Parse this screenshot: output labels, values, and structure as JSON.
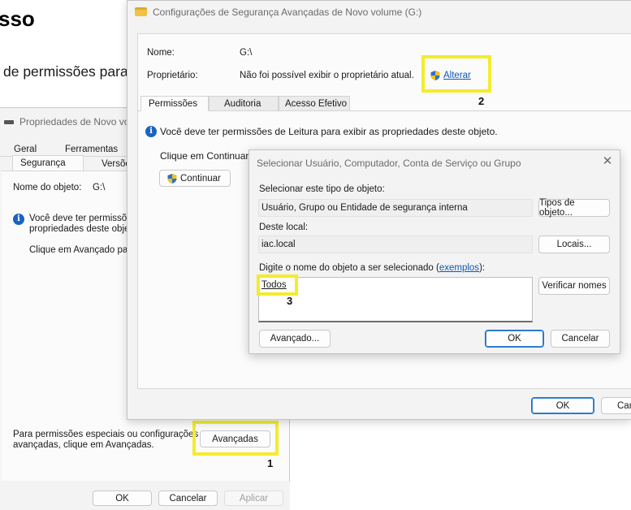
{
  "background_page": {
    "heading_fragment": "sso",
    "subheading_fragment": "de permissões para"
  },
  "properties_window": {
    "title": "Propriedades de Novo vo",
    "tabs_row1": [
      "Geral",
      "Ferramentas"
    ],
    "tabs_row2": [
      "Segurança",
      "Versõe"
    ],
    "object_name_label": "Nome do objeto:",
    "object_name_value": "G:\\",
    "info_text_line1": "Você deve ter permissões",
    "info_text_line2": "propriedades deste objeto",
    "advanced_hint": "Clique em Avançado para",
    "special_perms_line1": "Para permissões especiais ou configurações",
    "special_perms_line2": "avançadas, clique em Avançadas.",
    "advanced_button": "Avançadas",
    "ok_button": "OK",
    "cancel_button": "Cancelar",
    "apply_button": "Aplicar"
  },
  "advanced_window": {
    "title": "Configurações de Segurança Avançadas de Novo volume (G:)",
    "name_label": "Nome:",
    "name_value": "G:\\",
    "owner_label": "Proprietário:",
    "owner_value": "Não foi possível exibir o proprietário atual.",
    "change_link": "Alterar",
    "tabs": [
      "Permissões",
      "Auditoria",
      "Acesso Efetivo"
    ],
    "info_text": "Você deve ter permissões de Leitura para exibir as propriedades deste objeto.",
    "continue_hint": "Clique em Continuar",
    "continue_button": "Continuar",
    "ok_button": "OK",
    "cancel_button": "Can"
  },
  "select_dialog": {
    "title": "Selecionar Usuário, Computador, Conta de Serviço ou Grupo",
    "object_type_label": "Selecionar este tipo de objeto:",
    "object_type_value": "Usuário, Grupo ou Entidade de segurança interna",
    "object_types_button": "Tipos de objeto...",
    "location_label": "Deste local:",
    "location_value": "iac.local",
    "locations_button": "Locais...",
    "enter_name_label": "Digite o nome do objeto a ser selecionado (",
    "examples_link": "exemplos",
    "enter_name_suffix": "):",
    "object_name_input": "Todos",
    "check_names_button": "Verificar nomes",
    "advanced_button": "Avançado...",
    "ok_button": "OK",
    "cancel_button": "Cancelar"
  },
  "annotations": [
    "1",
    "2",
    "3"
  ],
  "colors": {
    "highlight": "#f4ec2c",
    "link": "#0a58b8",
    "info_icon": "#1a63c4",
    "primary_border": "#1f6fc4"
  }
}
